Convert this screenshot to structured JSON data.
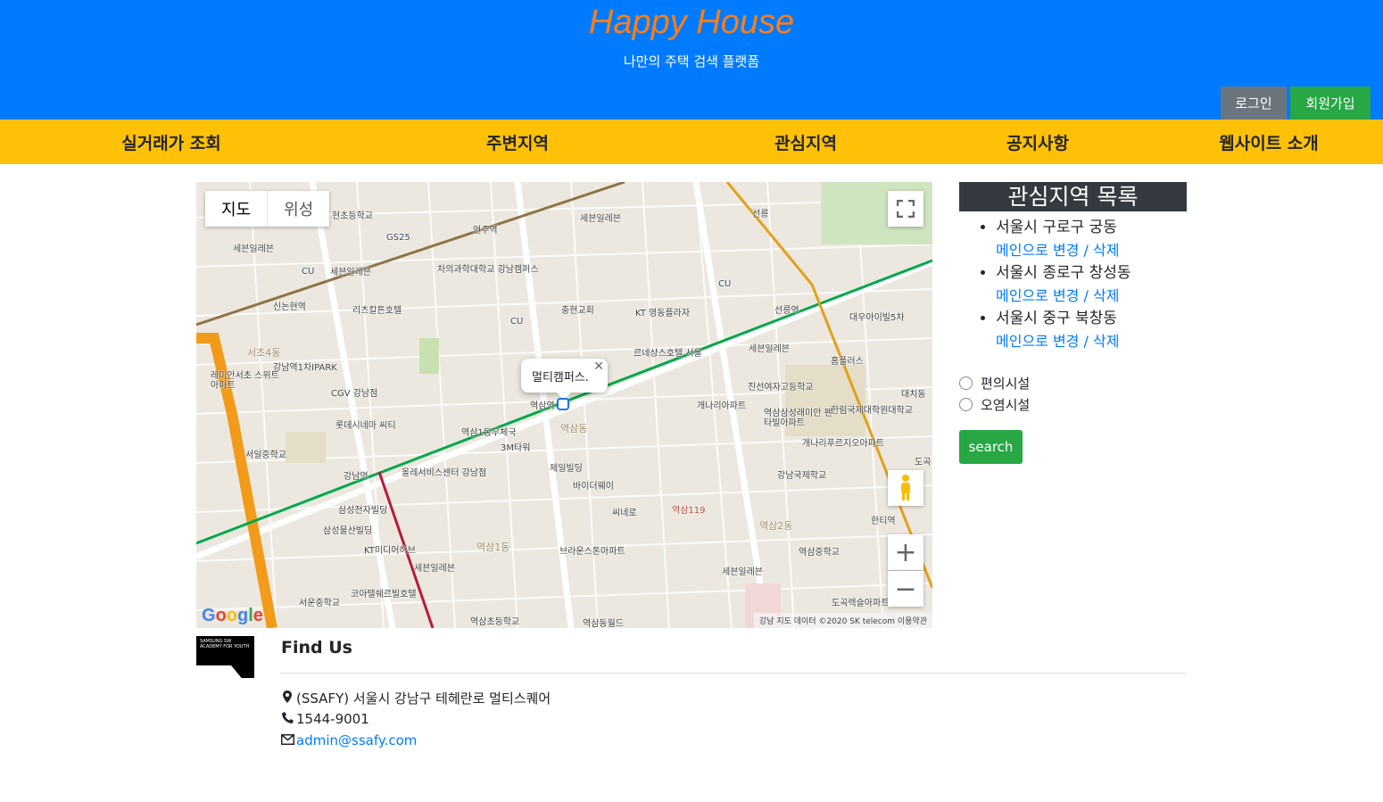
{
  "header": {
    "title": "Happy House",
    "subtitle": "나만의 주택 검색 플랫폼",
    "login_label": "로그인",
    "signup_label": "회원가입"
  },
  "nav": {
    "items": [
      {
        "label": "실거래가 조회"
      },
      {
        "label": "주변지역"
      },
      {
        "label": "관심지역"
      },
      {
        "label": "공지사항"
      },
      {
        "label": "웹사이트 소개"
      }
    ]
  },
  "map": {
    "type_map": "지도",
    "type_satellite": "위성",
    "info_window_text": "멀티캠퍼스.",
    "google": "Google",
    "attribution": "강남  지도 데이터 ©2020 SK telecom    이용약관",
    "labels": {
      "l1": "언주역",
      "l2": "세븐일레븐",
      "l3": "GS25",
      "l4": "현초등학교",
      "l5": "세븐일레븐",
      "l6": "차의과학대학교 강남캠퍼스",
      "l7": "신논현역",
      "l8": "리츠칼튼호텔",
      "l9": "충현교회",
      "l10": "KT 영동플라자",
      "l11": "선릉역",
      "l12": "대우아이빌5차",
      "l13": "서초4동",
      "l14": "강남역1차IPARK",
      "l15": "CGV 강남점",
      "l16": "르네상스호텔 서울",
      "l17": "세븐일레븐",
      "l18": "홈플러스",
      "l19": "진선여자고등학교",
      "l20": "롯데시네마 씨티",
      "l21": "역삼1동우체국",
      "l22": "역삼역",
      "l23": "역삼동",
      "l24": "개나리아파트",
      "l25": "역삼삼성래미안 펜타빌아파트",
      "l26": "한림국제대학원대학교",
      "l27": "서일중학교",
      "l28": "3M타워",
      "l29": "제일빌딩",
      "l30": "개나리푸르지오아파트",
      "l31": "강남역",
      "l32": "올레서비스센터 강남점",
      "l33": "바이더웨이",
      "l34": "강남국제학교",
      "l35": "삼성전자빌딩",
      "l36": "씨네로",
      "l37": "역삼119",
      "l38": "한티역",
      "l39": "삼성물산빌딩",
      "l40": "역삼1동",
      "l41": "역삼2동",
      "l42": "KT미디어허브",
      "l43": "브라운스톤아파트",
      "l44": "역삼중학교",
      "l45": "세븐일레븐",
      "l46": "세븐일레븐",
      "l47": "코아텔쉐르빌호텔",
      "l48": "서운중학교",
      "l49": "도곡렉슬아파트",
      "l50": "역삼초등학교",
      "l51": "역삼동월드",
      "l52": "레미안서초 스위트아파트",
      "l53": "선릉",
      "l54": "CU",
      "l55": "CU",
      "l56": "CU",
      "l57": "세븐일레븐",
      "l58": "대치동",
      "l59": "도곡"
    }
  },
  "sidebar": {
    "title": "관심지역 목록",
    "regions": [
      {
        "name": "서울시 구로구 궁동",
        "actions": "메인으로 변경 / 삭제"
      },
      {
        "name": "서울시 종로구 창성동",
        "actions": "메인으로 변경 / 삭제"
      },
      {
        "name": "서울시 중구 북창동",
        "actions": "메인으로 변경 / 삭제"
      }
    ],
    "radio_convenience": "편의시설",
    "radio_pollution": "오염시설",
    "search_label": "search"
  },
  "footer": {
    "logo_text": "SAMSUNG SW ACADEMY FOR YOUTH",
    "title": "Find Us",
    "address": "(SSAFY) 서울시 강남구 테헤란로 멀티스퀘어",
    "phone": "1544-9001",
    "email": "admin@ssafy.com"
  },
  "colors": {
    "header_bg": "#007bff",
    "title": "#fd7e14",
    "nav_bg": "#ffc107",
    "login": "#6c757d",
    "signup": "#28a745",
    "sidebar_title_bg": "#343a40",
    "link": "#007bff"
  }
}
